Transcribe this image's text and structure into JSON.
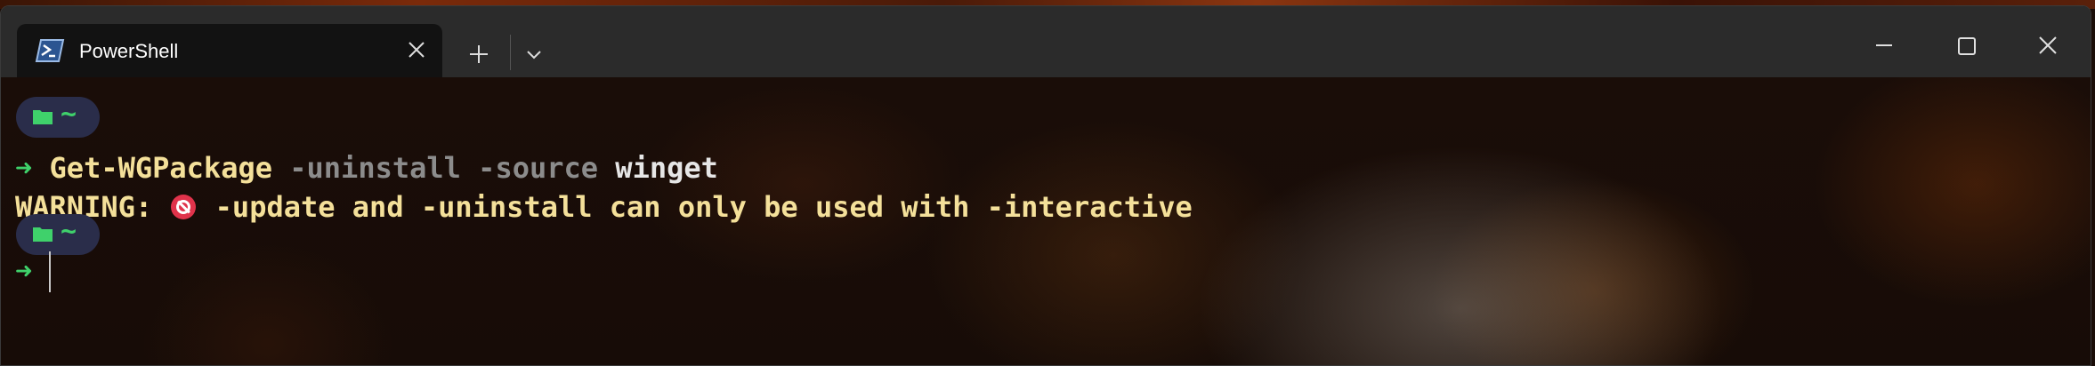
{
  "window": {
    "tab_title": "PowerShell",
    "tab_icon": "powershell-icon",
    "new_tab_icon": "plus-icon",
    "dropdown_icon": "chevron-down-icon",
    "minimize_icon": "minimize-icon",
    "maximize_icon": "maximize-icon",
    "close_icon": "close-icon"
  },
  "terminal": {
    "prompt_dir": "~",
    "prompt_arrow": "➜",
    "command_lines": [
      {
        "cmdlet": "Get-WGPackage",
        "params": "-uninstall -source",
        "arg": "winget"
      }
    ],
    "warning_prefix": "WARNING:",
    "warning_message": "-update and -uninstall can only be used with -interactive"
  },
  "colors": {
    "prompt_green": "#3fd16b",
    "command_yellow": "#f4e09a",
    "param_gray": "#8c8c8c",
    "pill_bg": "#2a2d4a",
    "error_red": "#e0334b"
  }
}
